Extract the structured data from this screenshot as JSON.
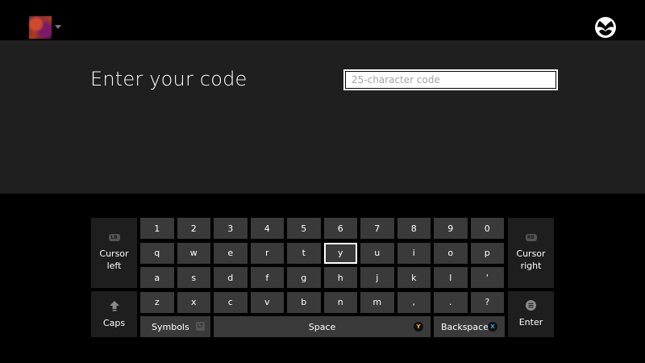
{
  "header": {
    "title": "Enter your code"
  },
  "code_input": {
    "placeholder": "25-character code",
    "value": ""
  },
  "keyboard": {
    "cursor_left": {
      "line1": "Cursor",
      "line2": "left",
      "glyph": "LB"
    },
    "cursor_right": {
      "line1": "Cursor",
      "line2": "right",
      "glyph": "RB"
    },
    "caps": {
      "label": "Caps"
    },
    "enter": {
      "label": "Enter"
    },
    "symbols": {
      "label": "Symbols",
      "glyph": "LT"
    },
    "space": {
      "label": "Space",
      "glyph": "Y"
    },
    "backspace": {
      "label": "Backspace",
      "glyph": "X"
    },
    "rows": [
      [
        "1",
        "2",
        "3",
        "4",
        "5",
        "6",
        "7",
        "8",
        "9",
        "0"
      ],
      [
        "q",
        "w",
        "e",
        "r",
        "t",
        "y",
        "u",
        "i",
        "o",
        "p"
      ],
      [
        "a",
        "s",
        "d",
        "f",
        "g",
        "h",
        "j",
        "k",
        "l",
        "'"
      ],
      [
        "z",
        "x",
        "c",
        "v",
        "b",
        "n",
        "m",
        ",",
        ".",
        "?"
      ]
    ],
    "selected_key": "y"
  },
  "colors": {
    "background": "#000000",
    "panel": "#1f1f1f",
    "key": "#3a3a3a",
    "side_key": "#1e1e1e",
    "y_button": "#f2c230",
    "x_button": "#3aa0e8"
  },
  "icons": {
    "brand": "xbox-logo-icon",
    "caps": "caps-arrow-icon",
    "enter": "menu-button-icon"
  }
}
